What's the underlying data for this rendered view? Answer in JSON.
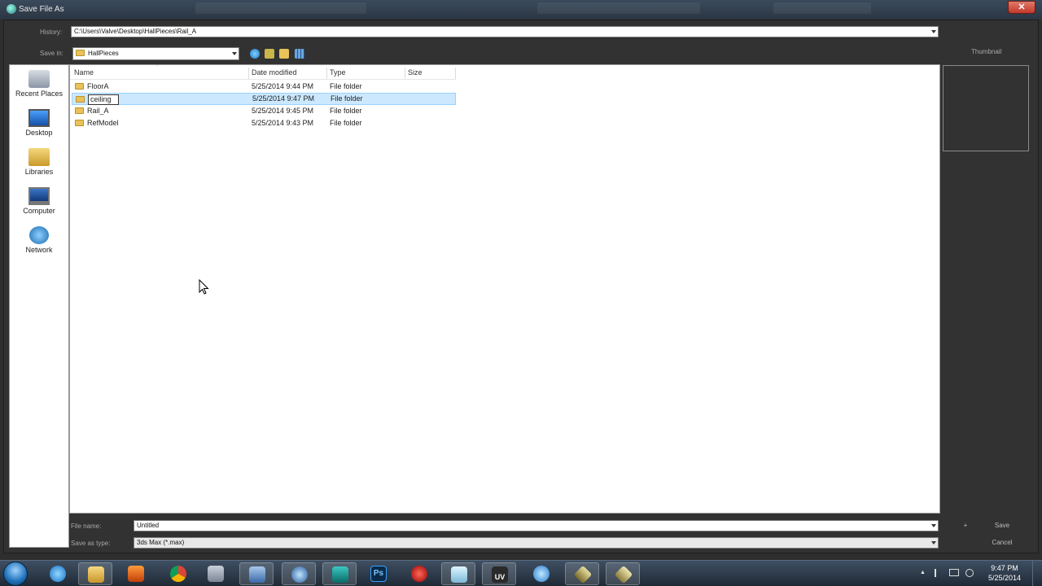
{
  "window": {
    "title": "Save File As",
    "close_glyph": "✕"
  },
  "history": {
    "label": "History:",
    "value": "C:\\Users\\Valve\\Desktop\\HallPieces\\Rail_A"
  },
  "save_in": {
    "label": "Save in:",
    "value": "HallPieces"
  },
  "toolbar_icons": [
    "back-icon",
    "up-folder-icon",
    "new-folder-icon",
    "view-menu-icon"
  ],
  "places": [
    {
      "label": "Recent Places",
      "icon": "recent-places-icon"
    },
    {
      "label": "Desktop",
      "icon": "desktop-icon"
    },
    {
      "label": "Libraries",
      "icon": "libraries-icon"
    },
    {
      "label": "Computer",
      "icon": "computer-icon"
    },
    {
      "label": "Network",
      "icon": "network-icon"
    }
  ],
  "columns": {
    "name": "Name",
    "date": "Date modified",
    "type": "Type",
    "size": "Size"
  },
  "rows": [
    {
      "name": "FloorA",
      "date": "5/25/2014 9:44 PM",
      "type": "File folder"
    },
    {
      "name": "ceiling",
      "date": "5/25/2014 9:47 PM",
      "type": "File folder"
    },
    {
      "name": "Rail_A",
      "date": "5/25/2014 9:45 PM",
      "type": "File folder"
    },
    {
      "name": "RefModel",
      "date": "5/25/2014 9:43 PM",
      "type": "File folder"
    }
  ],
  "selected_row": 1,
  "thumbnail": {
    "label": "Thumbnail"
  },
  "filename": {
    "label": "File name:",
    "value": "Untitled"
  },
  "filetype": {
    "label": "Save as type:",
    "value": "3ds Max (*.max)"
  },
  "buttons": {
    "plus": "+",
    "save": "Save",
    "cancel": "Cancel"
  },
  "taskbar": {
    "apps": [
      "internet-explorer-icon",
      "file-explorer-icon",
      "media-player-icon",
      "chrome-icon",
      "calculator-icon",
      "window-manager-icon",
      "network-tool-icon",
      "3ds-max-icon",
      "photoshop-icon",
      "red-app-icon",
      "notepad-icon",
      "uv-layout-icon",
      "itunes-icon",
      "tool-a-icon",
      "tool-b-icon"
    ],
    "photoshop_label": "Ps",
    "uv_label": "UV",
    "tray_arrow": "▲",
    "time": "9:47 PM",
    "date": "5/25/2014"
  },
  "colors": {
    "selection": "#cce8ff",
    "folder": "#e9c25a",
    "dialog_bg": "#323232"
  }
}
